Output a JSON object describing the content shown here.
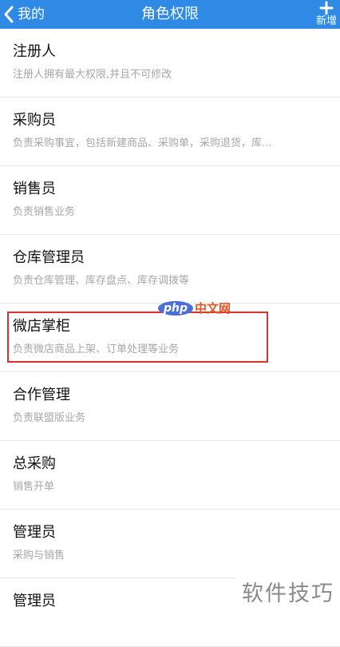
{
  "navbar": {
    "back_label": "我的",
    "title": "角色权限",
    "add_label": "新增",
    "color": "#2f8ae6"
  },
  "roles": [
    {
      "title": "注册人",
      "desc": "注册人拥有最大权限,并且不可修改"
    },
    {
      "title": "采购员",
      "desc": "负责采购事宜，包括新建商品、采购单，采购退货，库..."
    },
    {
      "title": "销售员",
      "desc": "负责销售业务"
    },
    {
      "title": "仓库管理员",
      "desc": "负责仓库管理、库存盘点、库存调拨等"
    },
    {
      "title": "微店掌柜",
      "desc": "负责微店商品上架、订单处理等业务"
    },
    {
      "title": "合作管理",
      "desc": "负责联盟版业务"
    },
    {
      "title": "总采购",
      "desc": "销售开单"
    },
    {
      "title": "管理员",
      "desc": "采购与销售"
    },
    {
      "title": "管理员",
      "desc": ""
    }
  ],
  "highlight_color": "#d9322e",
  "watermark": {
    "php": "php",
    "cn": "中文网",
    "corner": "软件技巧"
  }
}
